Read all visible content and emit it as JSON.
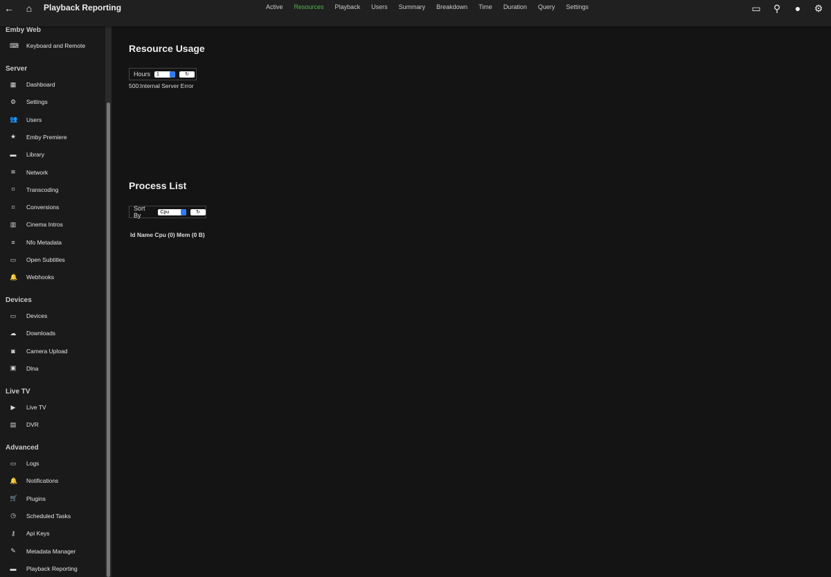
{
  "header": {
    "title": "Playback Reporting",
    "nav": [
      "Active",
      "Resources",
      "Playback",
      "Users",
      "Summary",
      "Breakdown",
      "Time",
      "Duration",
      "Query",
      "Settings"
    ],
    "active": "Resources"
  },
  "sidebar": {
    "sections": [
      {
        "title": "Emby Web",
        "items": [
          {
            "label": "Keyboard and Remote",
            "icon": "⌨"
          }
        ]
      },
      {
        "title": "Server",
        "items": [
          {
            "label": "Dashboard",
            "icon": "▦"
          },
          {
            "label": "Settings",
            "icon": "⚙"
          },
          {
            "label": "Users",
            "icon": "👥"
          },
          {
            "label": "Emby Premiere",
            "icon": "★"
          },
          {
            "label": "Library",
            "icon": "▬"
          },
          {
            "label": "Network",
            "icon": "≋"
          },
          {
            "label": "Transcoding",
            "icon": "⌗"
          },
          {
            "label": "Conversions",
            "icon": "⌗"
          },
          {
            "label": "Cinema Intros",
            "icon": "▥"
          },
          {
            "label": "Nfo Metadata",
            "icon": "≡"
          },
          {
            "label": "Open Subtitles",
            "icon": "▭"
          },
          {
            "label": "Webhooks",
            "icon": "🔔"
          }
        ]
      },
      {
        "title": "Devices",
        "items": [
          {
            "label": "Devices",
            "icon": "▭"
          },
          {
            "label": "Downloads",
            "icon": "☁"
          },
          {
            "label": "Camera Upload",
            "icon": "◙"
          },
          {
            "label": "Dlna",
            "icon": "▣"
          }
        ]
      },
      {
        "title": "Live TV",
        "items": [
          {
            "label": "Live TV",
            "icon": "▶"
          },
          {
            "label": "DVR",
            "icon": "▤"
          }
        ]
      },
      {
        "title": "Advanced",
        "items": [
          {
            "label": "Logs",
            "icon": "▭"
          },
          {
            "label": "Notifications",
            "icon": "🔔"
          },
          {
            "label": "Plugins",
            "icon": "🛒"
          },
          {
            "label": "Scheduled Tasks",
            "icon": "◷"
          },
          {
            "label": "Api Keys",
            "icon": "⚷"
          },
          {
            "label": "Metadata Manager",
            "icon": "✎"
          },
          {
            "label": "Playback Reporting",
            "icon": "▬"
          }
        ]
      }
    ]
  },
  "resource": {
    "title": "Resource Usage",
    "hours_label": "Hours",
    "hours_value": "1",
    "refresh": "↻",
    "error": "500:Internal Server Error"
  },
  "process": {
    "title": "Process List",
    "sort_label": "Sort By",
    "sort_value": "Cpu",
    "refresh": "↻",
    "columns": "Id Name Cpu (0) Mem (0 B)"
  }
}
